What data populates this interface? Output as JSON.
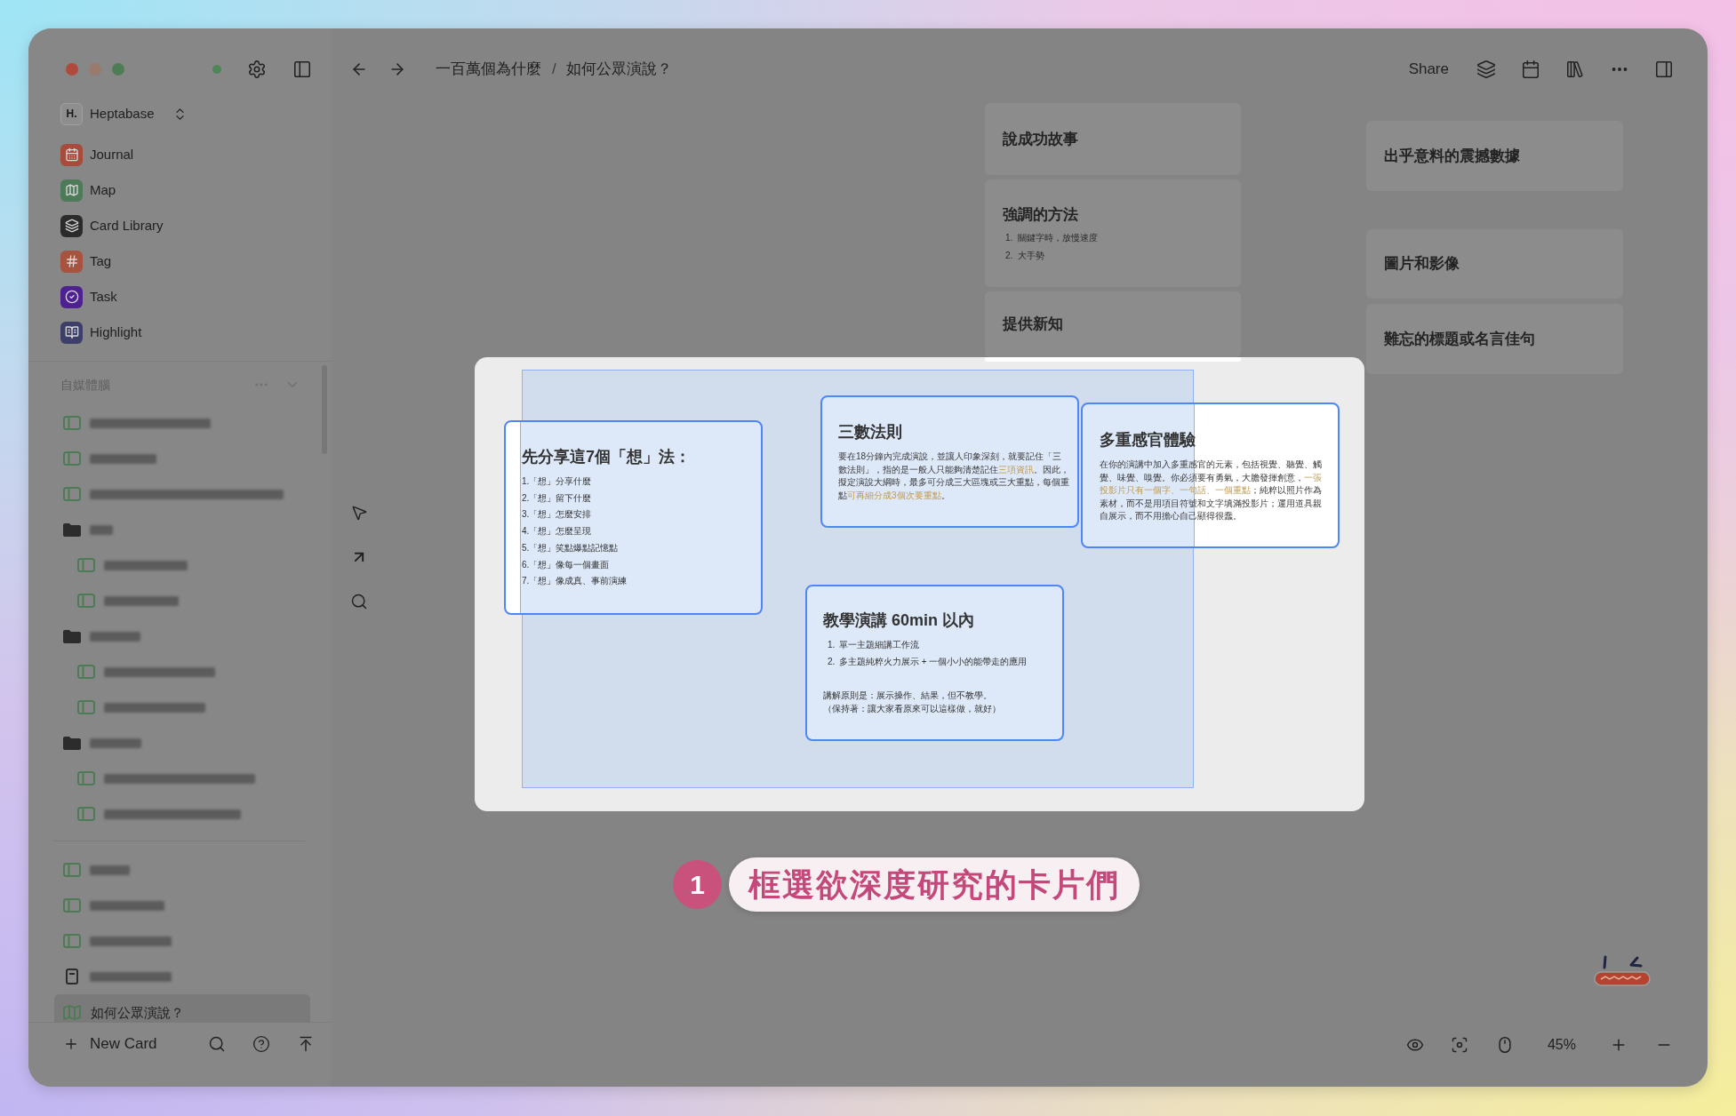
{
  "sidebar": {
    "workspace": {
      "logo": "H.",
      "name": "Heptabase"
    },
    "nav": [
      {
        "label": "Journal"
      },
      {
        "label": "Map"
      },
      {
        "label": "Card Library"
      },
      {
        "label": "Tag"
      },
      {
        "label": "Task"
      },
      {
        "label": "Highlight"
      }
    ],
    "section": {
      "title": "自媒體腦",
      "items": [
        {
          "kind": "card",
          "selected": false
        },
        {
          "kind": "card",
          "selected": false
        },
        {
          "kind": "card",
          "selected": false
        },
        {
          "kind": "folder",
          "selected": false,
          "children": [
            {
              "kind": "card",
              "selected": false
            },
            {
              "kind": "card",
              "selected": false
            }
          ]
        },
        {
          "kind": "folder",
          "selected": false,
          "children": [
            {
              "kind": "card",
              "selected": false
            },
            {
              "kind": "card",
              "selected": false
            }
          ]
        },
        {
          "kind": "folder",
          "selected": false,
          "children": [
            {
              "kind": "card",
              "selected": false
            },
            {
              "kind": "card",
              "selected": false
            }
          ]
        }
      ]
    },
    "recent": [
      {
        "kind": "card",
        "selected": false
      },
      {
        "kind": "card",
        "selected": false
      },
      {
        "kind": "card",
        "selected": false
      },
      {
        "kind": "document",
        "selected": false
      },
      {
        "kind": "whiteboard",
        "label": "如何公眾演說？",
        "selected": true
      }
    ],
    "new_card": "New Card"
  },
  "toolbar": {
    "breadcrumb": [
      "一百萬個為什麼",
      "如何公眾演說？"
    ],
    "separator": "/",
    "share": "Share"
  },
  "canvas": {
    "cards": [
      {
        "title": "說成功故事",
        "selected": false
      },
      {
        "title": "強調的方法",
        "list": [
          {
            "marker": "1.",
            "text": "關鍵字時，放慢速度"
          },
          {
            "marker": "2.",
            "text": "大手勢"
          }
        ],
        "selected": false
      },
      {
        "title": "提供新知",
        "selected": false
      },
      {
        "title": "出乎意料的震撼數據",
        "selected": false
      },
      {
        "title": "圖片和影像",
        "selected": false
      },
      {
        "title": "難忘的標題或名言佳句",
        "selected": false
      }
    ],
    "focus_panel": {
      "cards": [
        {
          "title": "先分享這7個「想」法：",
          "lines": [
            "1.「想」分享什麼",
            "2.「想」留下什麼",
            "3.「想」怎麼安排",
            "4.「想」怎麼呈現",
            "5.「想」笑點爆點記憶點",
            "6.「想」像每一個畫面",
            "7.「想」像成真、事前演練"
          ],
          "selected": true
        },
        {
          "title": "三數法則",
          "body": [
            {
              "text": "要在18分鐘內完成演說，並讓人印象深刻，就要記住「三數法則」，指的是一般人只能夠清楚記住",
              "highlight": false
            },
            {
              "text": "三項資訊",
              "highlight": true
            },
            {
              "text": "。因此，擬定演說大綱時，最多可分成三大區塊或三大重點，每個重點",
              "highlight": false
            },
            {
              "text": "可再細分成3個次要重點",
              "highlight": true
            },
            {
              "text": "。",
              "highlight": false
            }
          ],
          "selected": true
        },
        {
          "title": "多重感官體驗",
          "body": [
            {
              "text": "在你的演講中加入多重感官的元素，包括視覺、聽覺、觸覺、味覺、嗅覺。你必須要有勇氣，大膽發揮創意，",
              "highlight": false
            },
            {
              "text": "一張投影片只有一個字、一句話、一個重點",
              "highlight": true
            },
            {
              "text": "；純粹以照片作為素材，而不是用項目符號和文字填滿投影片；運用道具親自展示，而不用擔心自己顯得很蠢。",
              "highlight": false
            }
          ],
          "selected": true
        },
        {
          "title": "教學演講 60min 以內",
          "list": [
            {
              "marker": "1.",
              "text": "單一主題細講工作流"
            },
            {
              "marker": "2.",
              "text": "多主題純粹火力展示 + 一個小小的能帶走的應用"
            }
          ],
          "notes": [
            "講解原則是：展示操作、結果，但不教學。",
            "（保持著：讓大家看原來可以這樣做，就好）"
          ],
          "selected": true
        }
      ]
    },
    "zoom": "45%"
  },
  "callout": {
    "number": "1",
    "text": "框選欲深度研究的卡片們"
  }
}
